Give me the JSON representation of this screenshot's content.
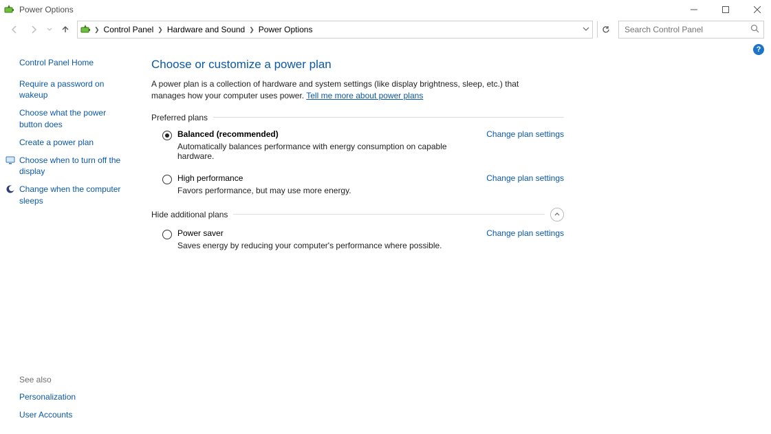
{
  "window": {
    "title": "Power Options"
  },
  "breadcrumbs": [
    "Control Panel",
    "Hardware and Sound",
    "Power Options"
  ],
  "search": {
    "placeholder": "Search Control Panel"
  },
  "sidebar": {
    "home": "Control Panel Home",
    "links": [
      {
        "label": "Require a password on wakeup",
        "icon": null
      },
      {
        "label": "Choose what the power button does",
        "icon": null
      },
      {
        "label": "Create a power plan",
        "icon": null
      },
      {
        "label": "Choose when to turn off the display",
        "icon": "monitor"
      },
      {
        "label": "Change when the computer sleeps",
        "icon": "moon"
      }
    ],
    "see_also_label": "See also",
    "see_also": [
      "Personalization",
      "User Accounts"
    ]
  },
  "main": {
    "heading": "Choose or customize a power plan",
    "description": "A power plan is a collection of hardware and system settings (like display brightness, sleep, etc.) that manages how your computer uses power. ",
    "description_link": "Tell me more about power plans",
    "preferred_label": "Preferred plans",
    "additional_label": "Hide additional plans",
    "change_link": "Change plan settings",
    "plans_preferred": [
      {
        "name": "Balanced (recommended)",
        "desc": "Automatically balances performance with energy consumption on capable hardware.",
        "selected": true
      },
      {
        "name": "High performance",
        "desc": "Favors performance, but may use more energy.",
        "selected": false
      }
    ],
    "plans_additional": [
      {
        "name": "Power saver",
        "desc": "Saves energy by reducing your computer's performance where possible.",
        "selected": false
      }
    ]
  }
}
